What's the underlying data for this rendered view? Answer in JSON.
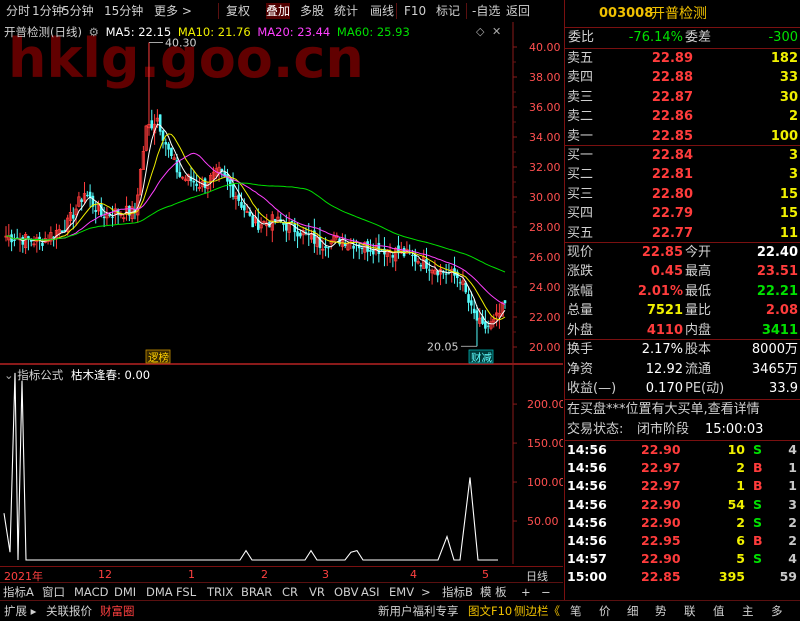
{
  "toolbar": {
    "items": [
      "分时",
      "1分钟",
      "5分钟",
      "15分钟",
      "更多 >",
      "复权",
      "叠加",
      "多股",
      "统计",
      "画线",
      "F10",
      "标记",
      "-自选",
      "返回"
    ],
    "active_index": 6
  },
  "main": {
    "title": "开普检测(日线)",
    "ma5": "MA5: 22.15",
    "ma10": "MA10: 21.76",
    "ma20": "MA20: 23.44",
    "ma60": "MA60: 25.93",
    "yticks": [
      "40.00",
      "38.00",
      "36.00",
      "34.00",
      "32.00",
      "30.00",
      "28.00",
      "26.00",
      "24.00",
      "22.00",
      "20.00"
    ],
    "high_label": "40.30",
    "low_label": "20.05",
    "tag_left": "逻榜",
    "tag_right": "财减",
    "watermark": "hklg.goo.cn",
    "colors": {
      "ma5": "#ffffff",
      "ma10": "#f0f000",
      "ma20": "#ff40ff",
      "ma60": "#00e000"
    }
  },
  "indicator": {
    "title": "指标公式",
    "name": "枯木逢春: 0.00",
    "yticks": [
      "200.00",
      "150.00",
      "100.00",
      "50.00"
    ]
  },
  "dates": [
    "2021年",
    "12",
    "1",
    "2",
    "3",
    "4",
    "5"
  ],
  "dates_right": "日线",
  "tabs": [
    "指标A",
    "窗口",
    "MACD",
    "DMI",
    "DMA",
    "FSL",
    "TRIX",
    "BRAR",
    "CR",
    "VR",
    "OBV",
    "ASI",
    "EMV",
    ">",
    "指标B",
    "模 板",
    "+",
    "−"
  ],
  "bottom": {
    "left": [
      "扩展 ▸",
      "关联报价",
      "财富圈"
    ],
    "right": [
      "新用户福利专享",
      "图文F10",
      "侧边栏《",
      "笔",
      "价",
      "细",
      "势",
      "联",
      "值",
      "主",
      "多"
    ]
  },
  "stock": {
    "code": "003008",
    "name": "开普检测"
  },
  "weibi": {
    "label": "委比",
    "value": "-76.14%",
    "label2": "委差",
    "value2": "-300"
  },
  "sell": [
    {
      "label": "卖五",
      "price": "22.89",
      "vol": "182"
    },
    {
      "label": "卖四",
      "price": "22.88",
      "vol": "33"
    },
    {
      "label": "卖三",
      "price": "22.87",
      "vol": "30"
    },
    {
      "label": "卖二",
      "price": "22.86",
      "vol": "2"
    },
    {
      "label": "卖一",
      "price": "22.85",
      "vol": "100"
    }
  ],
  "buy": [
    {
      "label": "买一",
      "price": "22.84",
      "vol": "3"
    },
    {
      "label": "买二",
      "price": "22.81",
      "vol": "3"
    },
    {
      "label": "买三",
      "price": "22.80",
      "vol": "15"
    },
    {
      "label": "买四",
      "price": "22.79",
      "vol": "15"
    },
    {
      "label": "买五",
      "price": "22.77",
      "vol": "11"
    }
  ],
  "quote": [
    {
      "l1": "现价",
      "v1": "22.85",
      "c1": "red",
      "l2": "今开",
      "v2": "22.40",
      "c2": "wht"
    },
    {
      "l1": "涨跌",
      "v1": "0.45",
      "c1": "red",
      "l2": "最高",
      "v2": "23.51",
      "c2": "red"
    },
    {
      "l1": "涨幅",
      "v1": "2.01%",
      "c1": "red",
      "l2": "最低",
      "v2": "22.21",
      "c2": "grn"
    },
    {
      "l1": "总量",
      "v1": "7521",
      "c1": "yel",
      "l2": "量比",
      "v2": "2.08",
      "c2": "red"
    },
    {
      "l1": "外盘",
      "v1": "4110",
      "c1": "red",
      "l2": "内盘",
      "v2": "3411",
      "c2": "grn"
    }
  ],
  "fund": [
    {
      "l1": "换手",
      "v1": "2.17%",
      "l2": "股本",
      "v2": "8000万"
    },
    {
      "l1": "净资",
      "v1": "12.92",
      "l2": "流通",
      "v2": "3465万"
    },
    {
      "l1": "收益(—)",
      "v1": "0.170",
      "l2": "PE(动)",
      "v2": "33.9"
    }
  ],
  "notice": "在买盘***位置有大买单,查看详情",
  "trade_status": {
    "label": "交易状态:",
    "value": "闭市阶段",
    "time": "15:00:03"
  },
  "ticks": [
    {
      "t": "14:56",
      "p": "22.90",
      "v": "10",
      "bs": "S",
      "n": "4"
    },
    {
      "t": "14:56",
      "p": "22.97",
      "v": "2",
      "bs": "B",
      "n": "1"
    },
    {
      "t": "14:56",
      "p": "22.97",
      "v": "1",
      "bs": "B",
      "n": "1"
    },
    {
      "t": "14:56",
      "p": "22.90",
      "v": "54",
      "bs": "S",
      "n": "3"
    },
    {
      "t": "14:56",
      "p": "22.90",
      "v": "2",
      "bs": "S",
      "n": "2"
    },
    {
      "t": "14:56",
      "p": "22.95",
      "v": "6",
      "bs": "B",
      "n": "2"
    },
    {
      "t": "14:57",
      "p": "22.90",
      "v": "5",
      "bs": "S",
      "n": "4"
    },
    {
      "t": "15:00",
      "p": "22.85",
      "v": "395",
      "bs": "",
      "n": "59"
    }
  ]
}
